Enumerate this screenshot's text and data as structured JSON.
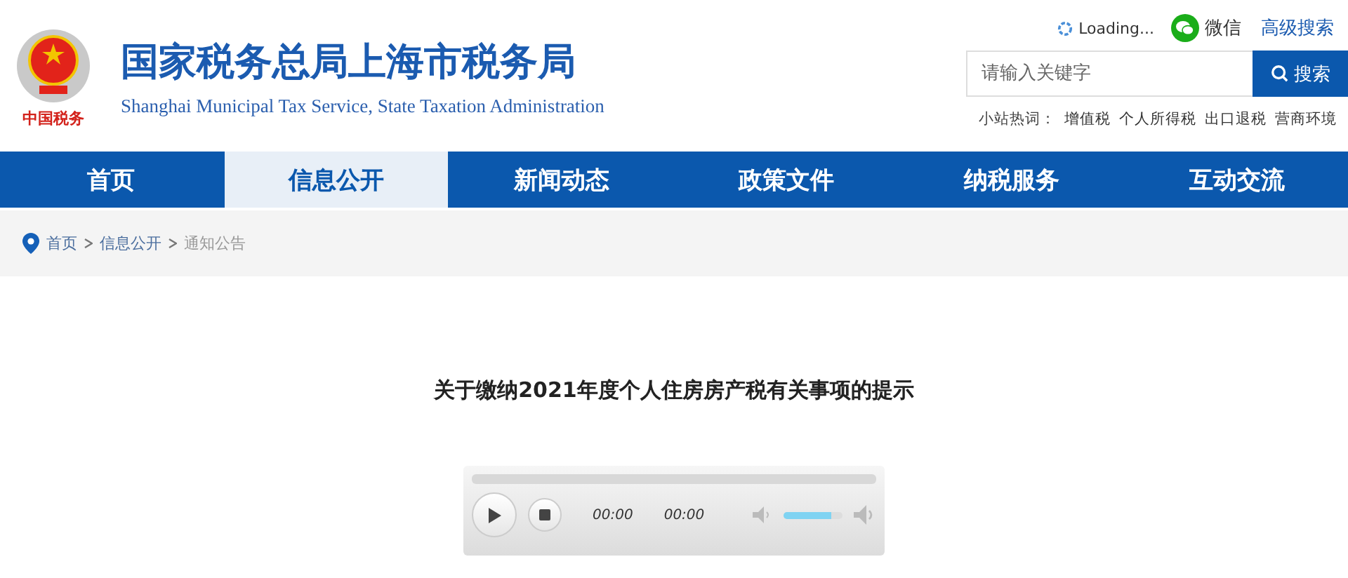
{
  "header": {
    "logo_caption": "中国税务",
    "site_title": "国家税务总局上海市税务局",
    "site_subtitle": "Shanghai Municipal Tax Service, State Taxation Administration",
    "loading": "Loading...",
    "wechat": "微信",
    "advanced_search": "高级搜索",
    "search": {
      "placeholder": "请输入关键字",
      "button": "搜索"
    },
    "hot_words_label": "小站热词：",
    "hot_words": [
      "增值税",
      "个人所得税",
      "出口退税",
      "营商环境"
    ]
  },
  "nav": [
    {
      "label": "首页",
      "selected": false
    },
    {
      "label": "信息公开",
      "selected": true
    },
    {
      "label": "新闻动态",
      "selected": false
    },
    {
      "label": "政策文件",
      "selected": false
    },
    {
      "label": "纳税服务",
      "selected": false
    },
    {
      "label": "互动交流",
      "selected": false
    }
  ],
  "breadcrumb": [
    "首页",
    "信息公开",
    "通知公告"
  ],
  "article": {
    "title": "关于缴纳2021年度个人住房房产税有关事项的提示"
  },
  "player": {
    "elapsed": "00:00",
    "duration": "00:00",
    "volume": {
      "level": 0.82
    }
  }
}
